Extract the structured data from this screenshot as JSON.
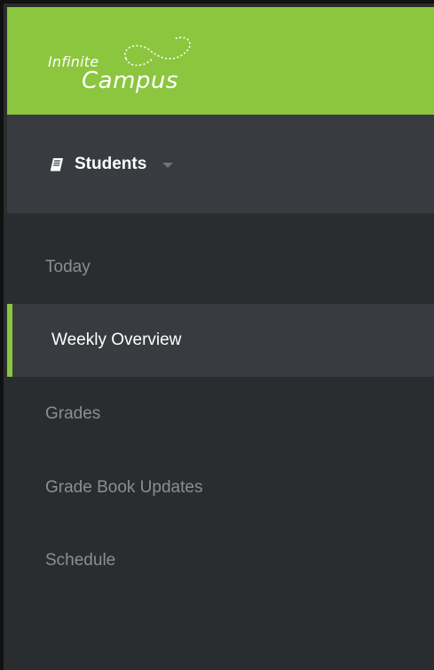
{
  "header": {
    "logo_line1": "Infinite",
    "logo_line2": "Campus",
    "brand_color": "#8cc63f"
  },
  "context": {
    "label": "Students",
    "icon": "book-icon",
    "dropdown_icon": "caret-down-icon"
  },
  "nav": {
    "items": [
      {
        "label": "Today",
        "active": false
      },
      {
        "label": "Weekly Overview",
        "active": true
      },
      {
        "label": "Grades",
        "active": false
      },
      {
        "label": "Grade Book Updates",
        "active": false
      },
      {
        "label": "Schedule",
        "active": false
      }
    ]
  },
  "colors": {
    "sidebar_bg": "#2a2d30",
    "active_bg": "#383c40",
    "inactive_text": "#8a8e92",
    "active_text": "#ffffff",
    "accent": "#8cc63f"
  }
}
